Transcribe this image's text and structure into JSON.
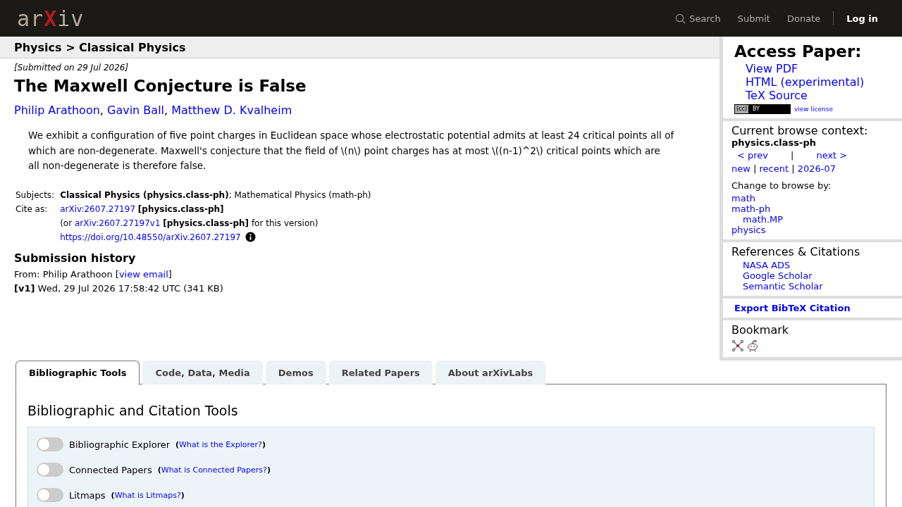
{
  "header": {
    "logo": {
      "before": "ar",
      "mark": "X",
      "after": "iv"
    },
    "nav": [
      {
        "label": "Search",
        "kind": "search"
      },
      {
        "label": "Submit",
        "kind": "link"
      },
      {
        "label": "Donate",
        "kind": "link"
      },
      {
        "label": "Log in",
        "kind": "login"
      }
    ]
  },
  "breadcrumb": "Physics > Classical Physics",
  "paper": {
    "dateline": "[Submitted on 29 Jul 2026]",
    "title": "The Maxwell Conjecture is False",
    "authors": [
      "Philip Arathoon",
      "Gavin Ball",
      "Matthew D. Kvalheim"
    ],
    "author_separator": ", ",
    "abstract": "We exhibit a configuration of five point charges in Euclidean space whose electrostatic potential admits at least 24 critical points all of which are non-degenerate. Maxwell's conjecture that the field of \\(n\\) point charges has at most \\((n-1)^2\\) critical points which are all non-degenerate is therefore false.",
    "subjects_label": "Subjects:",
    "subjects": "**Classical Physics (physics.class-ph)**; Mathematical Physics (math-ph)",
    "cite_label": "Cite as:",
    "cite": {
      "link": "arXiv:2607.27197",
      "after": " **[physics.class-ph]**"
    },
    "cite_version": {
      "before": "(or ",
      "link": "arXiv:2607.27197v1",
      "after": " **[physics.class-ph]** for this version)"
    },
    "doi": "https://doi.org/10.48550/arXiv.2607.27197",
    "history": {
      "heading": "Submission history",
      "from": {
        "before": "From: Philip Arathoon [",
        "link": "view email",
        "after": "]"
      },
      "versions": [
        "**[v1]** Wed, 29 Jul 2026 17:58:42 UTC (341 KB)"
      ]
    }
  },
  "sidebar": {
    "access": {
      "heading": "Access Paper:",
      "links": [
        "View PDF",
        "HTML (experimental)",
        "TeX Source"
      ],
      "license_badge": "BY",
      "license_cc": "(cc)",
      "license_link": "view license"
    },
    "browse": {
      "heading": "Current browse context:",
      "category": "physics.class-ph",
      "prev": "< prev",
      "sep": "|",
      "next": "next >",
      "periods": [
        "new",
        "recent",
        "2026-07"
      ],
      "period_sep": " | ",
      "change_label": "Change to browse by:",
      "categories": [
        {
          "label": "math"
        },
        {
          "label": "math-ph",
          "children": [
            {
              "label": "math.MP"
            }
          ]
        },
        {
          "label": "physics"
        }
      ]
    },
    "references": {
      "heading": "References & Citations",
      "links": [
        "NASA ADS",
        "Google Scholar",
        "Semantic Scholar"
      ]
    },
    "export": "Export BibTeX Citation",
    "bookmark": {
      "heading": "Bookmark",
      "icons": [
        {
          "kind": "bibsonomy"
        },
        {
          "kind": "reddit"
        }
      ]
    }
  },
  "tabs": [
    {
      "label": "Bibliographic Tools",
      "selected": true
    },
    {
      "label": "Code, Data, Media",
      "selected": false
    },
    {
      "label": "Demos",
      "selected": false
    },
    {
      "label": "Related Papers",
      "selected": false
    },
    {
      "label": "About arXivLabs",
      "selected": false
    }
  ],
  "panel": {
    "heading": "Bibliographic and Citation Tools",
    "tools": [
      {
        "label": "Bibliographic Explorer",
        "link": "What is the Explorer?",
        "on": false
      },
      {
        "label": "Connected Papers",
        "link": "What is Connected Papers?",
        "on": false
      },
      {
        "label": "Litmaps",
        "link": "What is Litmaps?",
        "on": false
      }
    ],
    "paren_open": "(",
    "paren_close": ")"
  }
}
